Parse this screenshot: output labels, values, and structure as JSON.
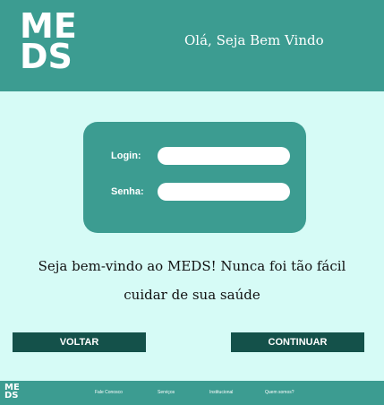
{
  "header": {
    "logo_line1": "ME",
    "logo_line2": "DS",
    "greeting": "Olá, Seja Bem Vindo"
  },
  "login_form": {
    "login_label": "Login:",
    "login_value": "",
    "password_label": "Senha:",
    "password_value": ""
  },
  "welcome": {
    "line1": "Seja bem-vindo ao MEDS! Nunca foi tão fácil",
    "line2": "cuidar de sua saúde"
  },
  "actions": {
    "back_label": "VOLTAR",
    "continue_label": "CONTINUAR"
  },
  "footer": {
    "logo_line1": "ME",
    "logo_line2": "DS",
    "links": [
      "Fale Conosco",
      "Serviços",
      "Institucional",
      "Quem somos?"
    ]
  },
  "colors": {
    "primary": "#3c9c91",
    "background": "#d6fbf6",
    "button": "#14514a"
  }
}
